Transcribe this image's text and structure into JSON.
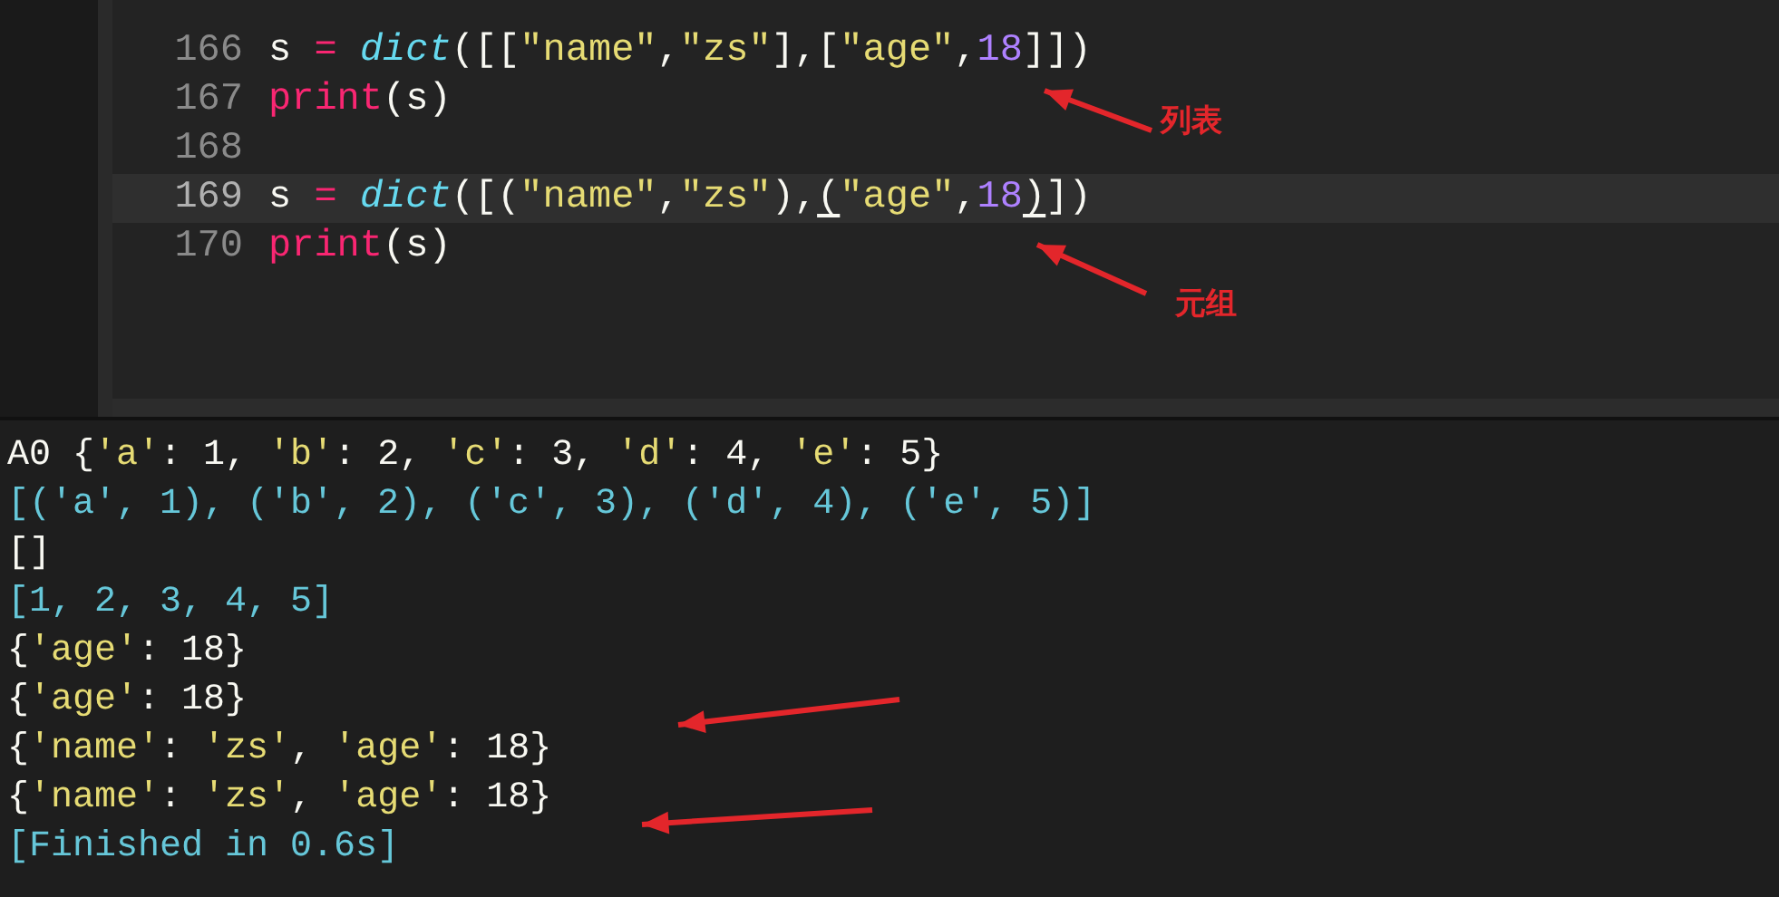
{
  "editor": {
    "lines": [
      {
        "number": "166",
        "highlighted": false,
        "tokens": [
          {
            "kind": "plain",
            "text": "s "
          },
          {
            "kind": "operator",
            "text": "= "
          },
          {
            "kind": "builtin",
            "text": "dict"
          },
          {
            "kind": "plain",
            "text": "([["
          },
          {
            "kind": "string",
            "text": "\"name\""
          },
          {
            "kind": "plain",
            "text": ","
          },
          {
            "kind": "string",
            "text": "\"zs\""
          },
          {
            "kind": "plain",
            "text": "],["
          },
          {
            "kind": "string",
            "text": "\"age\""
          },
          {
            "kind": "plain",
            "text": ","
          },
          {
            "kind": "number",
            "text": "18"
          },
          {
            "kind": "plain",
            "text": "]])"
          }
        ]
      },
      {
        "number": "167",
        "highlighted": false,
        "tokens": [
          {
            "kind": "function",
            "text": "print"
          },
          {
            "kind": "plain",
            "text": "(s)"
          }
        ]
      },
      {
        "number": "168",
        "highlighted": false
      },
      {
        "number": "169",
        "highlighted": true,
        "tokens": [
          {
            "kind": "plain",
            "text": "s "
          },
          {
            "kind": "operator",
            "text": "= "
          },
          {
            "kind": "builtin",
            "text": "dict"
          },
          {
            "kind": "plain",
            "text": "([("
          },
          {
            "kind": "string",
            "text": "\"name\""
          },
          {
            "kind": "plain",
            "text": ","
          },
          {
            "kind": "string",
            "text": "\"zs\""
          },
          {
            "kind": "plain",
            "text": "),"
          },
          {
            "kind": "bracket_match",
            "text": "("
          },
          {
            "kind": "string",
            "text": "\"age\""
          },
          {
            "kind": "plain",
            "text": ","
          },
          {
            "kind": "number",
            "text": "18"
          },
          {
            "kind": "bracket_match",
            "text": ")"
          },
          {
            "kind": "plain",
            "text": "])"
          }
        ]
      },
      {
        "number": "170",
        "highlighted": false,
        "tokens": [
          {
            "kind": "function",
            "text": "print"
          },
          {
            "kind": "plain",
            "text": "(s)"
          }
        ]
      }
    ],
    "annotations": [
      {
        "label": "列表"
      },
      {
        "label": "元组"
      }
    ]
  },
  "output": {
    "lines": [
      {
        "kind": "plain",
        "tokens": [
          {
            "kind": "plain",
            "text": "A0 {"
          },
          {
            "kind": "string",
            "text": "'a'"
          },
          {
            "kind": "plain",
            "text": ": 1, "
          },
          {
            "kind": "string",
            "text": "'b'"
          },
          {
            "kind": "plain",
            "text": ": 2, "
          },
          {
            "kind": "string",
            "text": "'c'"
          },
          {
            "kind": "plain",
            "text": ": 3, "
          },
          {
            "kind": "string",
            "text": "'d'"
          },
          {
            "kind": "plain",
            "text": ": 4, "
          },
          {
            "kind": "string",
            "text": "'e'"
          },
          {
            "kind": "plain",
            "text": ": 5}"
          }
        ]
      },
      {
        "kind": "list",
        "tokens": [
          {
            "kind": "plain",
            "text": "[('a', 1), ('b', 2), ('c', 3), ('d', 4), ('e', 5)]"
          }
        ]
      },
      {
        "kind": "plain",
        "tokens": [
          {
            "kind": "plain",
            "text": "[]"
          }
        ]
      },
      {
        "kind": "list",
        "tokens": [
          {
            "kind": "plain",
            "text": "[1, 2, 3, 4, 5]"
          }
        ]
      },
      {
        "kind": "plain",
        "tokens": [
          {
            "kind": "plain",
            "text": "{"
          },
          {
            "kind": "string",
            "text": "'age'"
          },
          {
            "kind": "plain",
            "text": ": 18}"
          }
        ]
      },
      {
        "kind": "plain",
        "tokens": [
          {
            "kind": "plain",
            "text": "{"
          },
          {
            "kind": "string",
            "text": "'age'"
          },
          {
            "kind": "plain",
            "text": ": 18}"
          }
        ]
      },
      {
        "kind": "plain",
        "tokens": [
          {
            "kind": "plain",
            "text": "{"
          },
          {
            "kind": "string",
            "text": "'name'"
          },
          {
            "kind": "plain",
            "text": ": "
          },
          {
            "kind": "string",
            "text": "'zs'"
          },
          {
            "kind": "plain",
            "text": ", "
          },
          {
            "kind": "string",
            "text": "'age'"
          },
          {
            "kind": "plain",
            "text": ": 18}"
          }
        ]
      },
      {
        "kind": "plain",
        "tokens": [
          {
            "kind": "plain",
            "text": "{"
          },
          {
            "kind": "string",
            "text": "'name'"
          },
          {
            "kind": "plain",
            "text": ": "
          },
          {
            "kind": "string",
            "text": "'zs'"
          },
          {
            "kind": "plain",
            "text": ", "
          },
          {
            "kind": "string",
            "text": "'age'"
          },
          {
            "kind": "plain",
            "text": ": 18}"
          }
        ]
      },
      {
        "kind": "list",
        "tokens": [
          {
            "kind": "plain",
            "text": "[Finished in 0.6s]"
          }
        ]
      }
    ]
  }
}
